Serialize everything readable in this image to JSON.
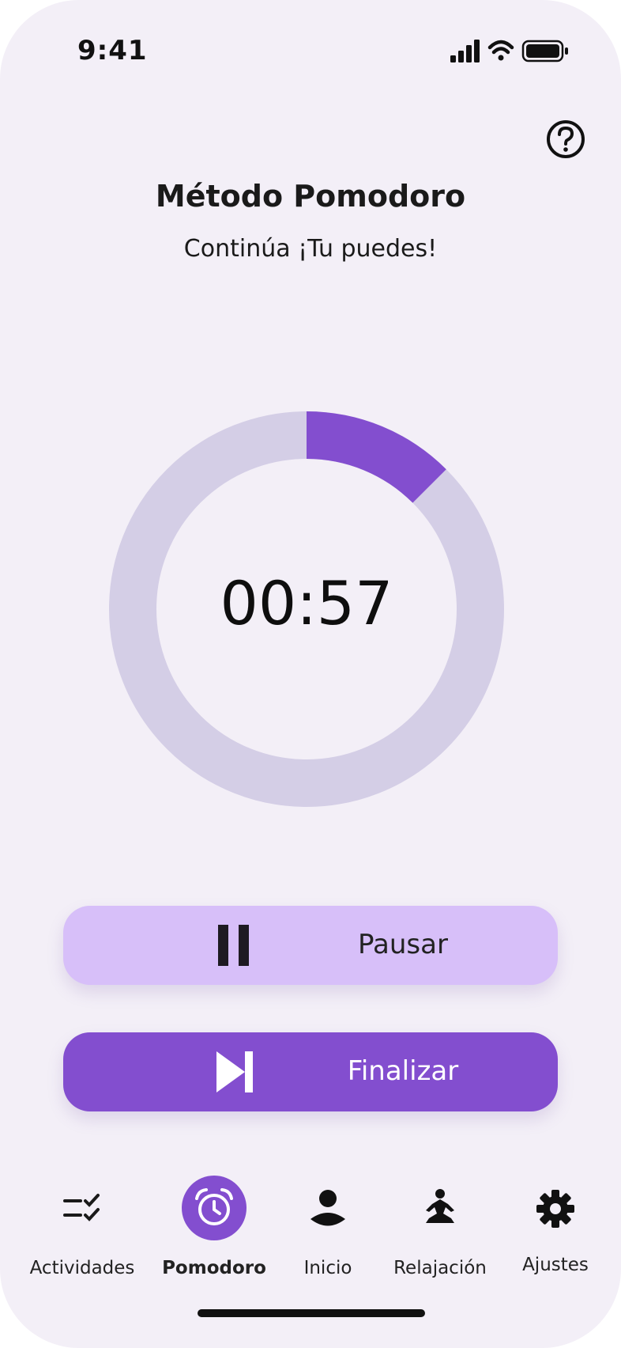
{
  "status_bar": {
    "time": "9:41"
  },
  "header": {
    "title": "Método Pomodoro",
    "subtitle": "Continúa ¡Tu puedes!"
  },
  "timer": {
    "display": "00:57",
    "progress_fraction": 0.125
  },
  "buttons": {
    "pause_label": "Pausar",
    "finish_label": "Finalizar"
  },
  "nav": {
    "items": [
      {
        "label": "Actividades",
        "icon": "checklist-icon",
        "active": false
      },
      {
        "label": "Pomodoro",
        "icon": "alarm-clock-icon",
        "active": true
      },
      {
        "label": "Inicio",
        "icon": "user-icon",
        "active": false
      },
      {
        "label": "Relajación",
        "icon": "meditation-icon",
        "active": false
      },
      {
        "label": "Ajustes",
        "icon": "gear-icon",
        "active": false
      }
    ]
  },
  "colors": {
    "background": "#F3EFF7",
    "accent": "#834ECF",
    "accent_light": "#D7BFF9",
    "ring_track": "#D4CEE6"
  }
}
